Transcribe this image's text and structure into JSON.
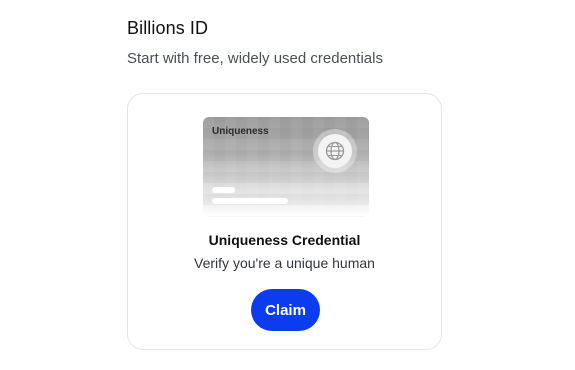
{
  "section": {
    "title": "Billions ID",
    "subtitle": "Start with free, widely used credentials"
  },
  "credential_card": {
    "visual_label": "Uniqueness",
    "badge_icon": "globe-icon",
    "name": "Uniqueness Credential",
    "description": "Verify you're a unique human",
    "claim_label": "Claim",
    "accent_color": "#0b3cf0"
  }
}
